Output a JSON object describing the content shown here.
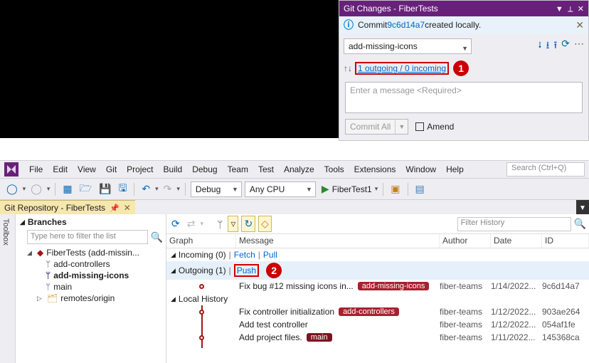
{
  "gitPanel": {
    "title": "Git Changes - FiberTests",
    "infoPrefix": "Commit ",
    "commitHash": "9c6d14a7",
    "infoSuffix": " created locally.",
    "branch": "add-missing-icons",
    "outgoingLink": "1 outgoing / 0 incoming",
    "callout1": "1",
    "msgPlaceholder": "Enter a message <Required>",
    "commitBtn": "Commit All",
    "amend": "Amend"
  },
  "menu": {
    "items": [
      "File",
      "Edit",
      "View",
      "Git",
      "Project",
      "Build",
      "Debug",
      "Team",
      "Test",
      "Analyze",
      "Tools",
      "Extensions",
      "Window",
      "Help"
    ],
    "searchPlaceholder": "Search (Ctrl+Q)"
  },
  "toolbar": {
    "config": "Debug",
    "platform": "Any CPU",
    "runTarget": "FiberTest1"
  },
  "tab": {
    "title": "Git Repository - FiberTests"
  },
  "sideToolbox": "Toolbox",
  "branchesPane": {
    "header": "Branches",
    "filterPlaceholder": "Type here to filter the list",
    "repo": "FiberTests (add-missin...",
    "b1": "add-controllers",
    "b2": "add-missing-icons",
    "b3": "main",
    "remotes": "remotes/origin"
  },
  "history": {
    "filterPlaceholder": "Filter History",
    "cols": {
      "graph": "Graph",
      "msg": "Message",
      "auth": "Author",
      "date": "Date",
      "id": "ID"
    },
    "incoming": "Incoming (0)",
    "fetch": "Fetch",
    "pull": "Pull",
    "outgoing": "Outgoing (1)",
    "push": "Push",
    "callout2": "2",
    "local": "Local History",
    "rows": [
      {
        "msg": "Fix bug #12 missing icons in...",
        "badge": "add-missing-icons",
        "badgeCls": "b-red",
        "auth": "fiber-teams",
        "date": "1/14/2022...",
        "id": "9c6d14a7"
      },
      {
        "msg": "Fix controller initialization",
        "badge": "add-controllers",
        "badgeCls": "b-red",
        "auth": "fiber-teams",
        "date": "1/12/2022...",
        "id": "903ae264"
      },
      {
        "msg": "Add test controller",
        "badge": "",
        "badgeCls": "",
        "auth": "fiber-teams",
        "date": "1/12/2022...",
        "id": "054af1fe"
      },
      {
        "msg": "Add project files.",
        "badge": "main",
        "badgeCls": "b-dark",
        "auth": "fiber-teams",
        "date": "1/11/2022...",
        "id": "145368ca"
      }
    ]
  }
}
